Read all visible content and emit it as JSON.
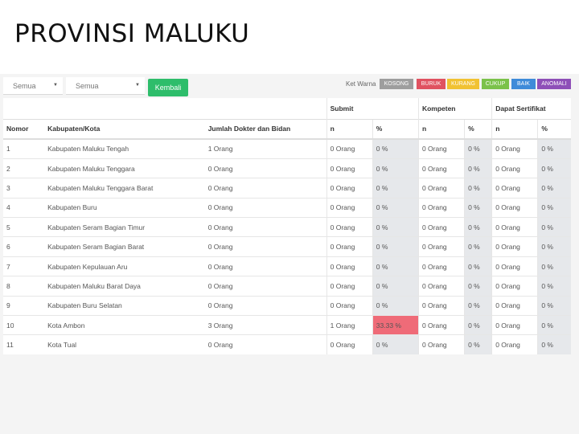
{
  "slide": {
    "title": "PROVINSI MALUKU"
  },
  "toolbar": {
    "filter1": "Semua",
    "filter2": "Semua",
    "back_label": "Kembali",
    "legend_label": "Ket Warna",
    "legend": [
      {
        "label": "KOSONG",
        "color": "#9e9e9e"
      },
      {
        "label": "BURUK",
        "color": "#e05260"
      },
      {
        "label": "KURANG",
        "color": "#f1c232"
      },
      {
        "label": "CUKUP",
        "color": "#7bc24a"
      },
      {
        "label": "BAIK",
        "color": "#3f8bd9"
      },
      {
        "label": "ANOMALI",
        "color": "#8e4fb8"
      }
    ]
  },
  "table": {
    "groups": {
      "submit": "Submit",
      "kompeten": "Kompeten",
      "sertifikat": "Dapat Sertifikat"
    },
    "columns": {
      "nomor": "Nomor",
      "kabupaten": "Kabupaten/Kota",
      "jumlah": "Jumlah Dokter dan Bidan",
      "n": "n",
      "pct": "%"
    },
    "rows": [
      {
        "no": "1",
        "name": "Kabupaten Maluku Tengah",
        "jumlah": "1 Orang",
        "s_n": "0 Orang",
        "s_p": "0 %",
        "k_n": "0 Orang",
        "k_p": "0 %",
        "d_n": "0 Orang",
        "d_p": "0 %"
      },
      {
        "no": "2",
        "name": "Kabupaten Maluku Tenggara",
        "jumlah": "0 Orang",
        "s_n": "0 Orang",
        "s_p": "0 %",
        "k_n": "0 Orang",
        "k_p": "0 %",
        "d_n": "0 Orang",
        "d_p": "0 %"
      },
      {
        "no": "3",
        "name": "Kabupaten Maluku Tenggara Barat",
        "jumlah": "0 Orang",
        "s_n": "0 Orang",
        "s_p": "0 %",
        "k_n": "0 Orang",
        "k_p": "0 %",
        "d_n": "0 Orang",
        "d_p": "0 %"
      },
      {
        "no": "4",
        "name": "Kabupaten Buru",
        "jumlah": "0 Orang",
        "s_n": "0 Orang",
        "s_p": "0 %",
        "k_n": "0 Orang",
        "k_p": "0 %",
        "d_n": "0 Orang",
        "d_p": "0 %"
      },
      {
        "no": "5",
        "name": "Kabupaten Seram Bagian Timur",
        "jumlah": "0 Orang",
        "s_n": "0 Orang",
        "s_p": "0 %",
        "k_n": "0 Orang",
        "k_p": "0 %",
        "d_n": "0 Orang",
        "d_p": "0 %"
      },
      {
        "no": "6",
        "name": "Kabupaten Seram Bagian Barat",
        "jumlah": "0 Orang",
        "s_n": "0 Orang",
        "s_p": "0 %",
        "k_n": "0 Orang",
        "k_p": "0 %",
        "d_n": "0 Orang",
        "d_p": "0 %"
      },
      {
        "no": "7",
        "name": "Kabupaten Kepulauan Aru",
        "jumlah": "0 Orang",
        "s_n": "0 Orang",
        "s_p": "0 %",
        "k_n": "0 Orang",
        "k_p": "0 %",
        "d_n": "0 Orang",
        "d_p": "0 %"
      },
      {
        "no": "8",
        "name": "Kabupaten Maluku Barat Daya",
        "jumlah": "0 Orang",
        "s_n": "0 Orang",
        "s_p": "0 %",
        "k_n": "0 Orang",
        "k_p": "0 %",
        "d_n": "0 Orang",
        "d_p": "0 %"
      },
      {
        "no": "9",
        "name": "Kabupaten Buru Selatan",
        "jumlah": "0 Orang",
        "s_n": "0 Orang",
        "s_p": "0 %",
        "k_n": "0 Orang",
        "k_p": "0 %",
        "d_n": "0 Orang",
        "d_p": "0 %"
      },
      {
        "no": "10",
        "name": "Kota Ambon",
        "jumlah": "3 Orang",
        "s_n": "1 Orang",
        "s_p": "33.33 %",
        "k_n": "0 Orang",
        "k_p": "0 %",
        "d_n": "0 Orang",
        "d_p": "0 %",
        "s_p_status": "BURUK"
      },
      {
        "no": "11",
        "name": "Kota Tual",
        "jumlah": "0 Orang",
        "s_n": "0 Orang",
        "s_p": "0 %",
        "k_n": "0 Orang",
        "k_p": "0 %",
        "d_n": "0 Orang",
        "d_p": "0 %"
      }
    ]
  }
}
